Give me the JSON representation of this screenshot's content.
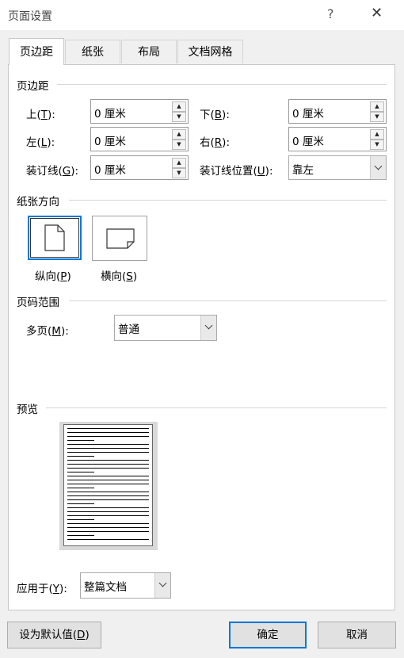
{
  "window": {
    "title": "页面设置",
    "help": "?",
    "close": "✕"
  },
  "tabs": [
    {
      "label": "页边距",
      "active": true
    },
    {
      "label": "纸张",
      "active": false
    },
    {
      "label": "布局",
      "active": false
    },
    {
      "label": "文档网格",
      "active": false
    }
  ],
  "margins": {
    "section_title": "页边距",
    "top": {
      "label_pre": "上(",
      "key": "T",
      "label_post": "):",
      "value": "0 厘米"
    },
    "bottom": {
      "label_pre": "下(",
      "key": "B",
      "label_post": "):",
      "value": "0 厘米"
    },
    "left": {
      "label_pre": "左(",
      "key": "L",
      "label_post": "):",
      "value": "0 厘米"
    },
    "right": {
      "label_pre": "右(",
      "key": "R",
      "label_post": "):",
      "value": "0 厘米"
    },
    "gutter": {
      "label_pre": "装订线(",
      "key": "G",
      "label_post": "):",
      "value": "0 厘米"
    },
    "gutter_pos": {
      "label_pre": "装订线位置(",
      "key": "U",
      "label_post": "):",
      "value": "靠左"
    }
  },
  "orientation": {
    "section_title": "纸张方向",
    "portrait": {
      "label_pre": "纵向(",
      "key": "P",
      "label_post": ")",
      "selected": true
    },
    "landscape": {
      "label_pre": "横向(",
      "key": "S",
      "label_post": ")",
      "selected": false
    }
  },
  "pages": {
    "section_title": "页码范围",
    "multiple": {
      "label_pre": "多页(",
      "key": "M",
      "label_post": "):",
      "value": "普通"
    }
  },
  "preview": {
    "section_title": "预览"
  },
  "apply_to": {
    "label_pre": "应用于(",
    "key": "Y",
    "label_post": "):",
    "value": "整篇文档"
  },
  "buttons": {
    "default": {
      "label_pre": "设为默认值(",
      "key": "D",
      "label_post": ")"
    },
    "ok": "确定",
    "cancel": "取消"
  },
  "colors": {
    "accent": "#0078d7",
    "panel": "#ffffff",
    "chrome": "#f0f0f0"
  }
}
